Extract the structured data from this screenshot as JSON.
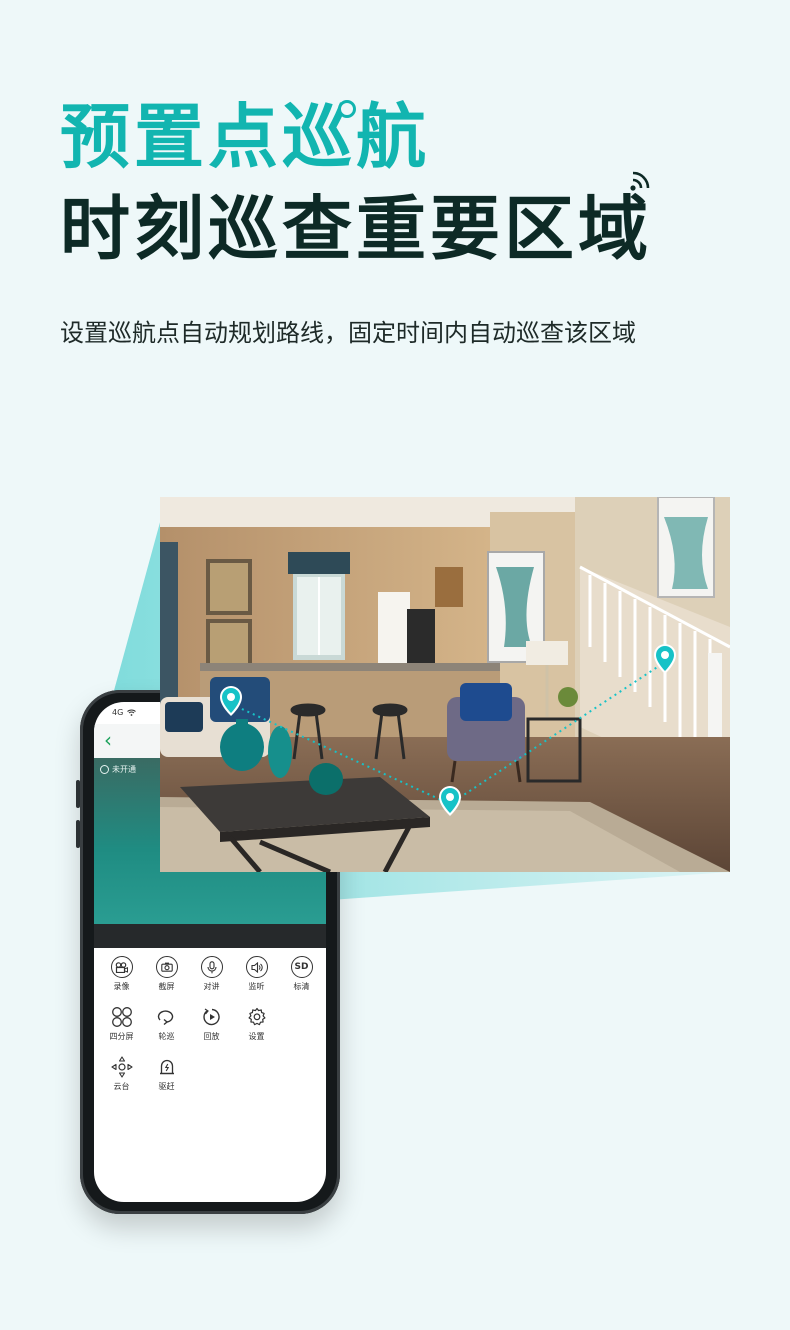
{
  "colors": {
    "accent": "#12b5b0",
    "title_dark": "#0d2a26",
    "marker": "#17c2c7",
    "app_green": "#1aa15a"
  },
  "header": {
    "title_line1": "预置点巡航",
    "title_line2": "时刻巡查重要区域",
    "subtitle": "设置巡航点自动规划路线，固定时间内自动巡查该区域"
  },
  "phone": {
    "status": {
      "network": "4G",
      "signal_icon": "wifi-icon"
    },
    "header": {
      "back_icon": "chevron-left-icon"
    },
    "video": {
      "status_label": "未开通"
    },
    "controls": [
      [
        {
          "label": "录像",
          "icon": "video-record-icon"
        },
        {
          "label": "截屏",
          "icon": "camera-icon"
        },
        {
          "label": "对讲",
          "icon": "microphone-icon"
        },
        {
          "label": "监听",
          "icon": "speaker-icon"
        },
        {
          "label": "标清",
          "icon": "sd-icon",
          "glyph": "SD"
        }
      ],
      [
        {
          "label": "四分屏",
          "icon": "quad-screen-icon"
        },
        {
          "label": "轮巡",
          "icon": "patrol-loop-icon"
        },
        {
          "label": "回放",
          "icon": "playback-icon"
        },
        {
          "label": "设置",
          "icon": "gear-icon"
        }
      ],
      [
        {
          "label": "云台",
          "icon": "ptz-direction-icon"
        },
        {
          "label": "驱赶",
          "icon": "alarm-light-icon"
        }
      ]
    ]
  },
  "scene": {
    "waypoint_icon": "map-pin-icon",
    "route_style": "dotted"
  }
}
